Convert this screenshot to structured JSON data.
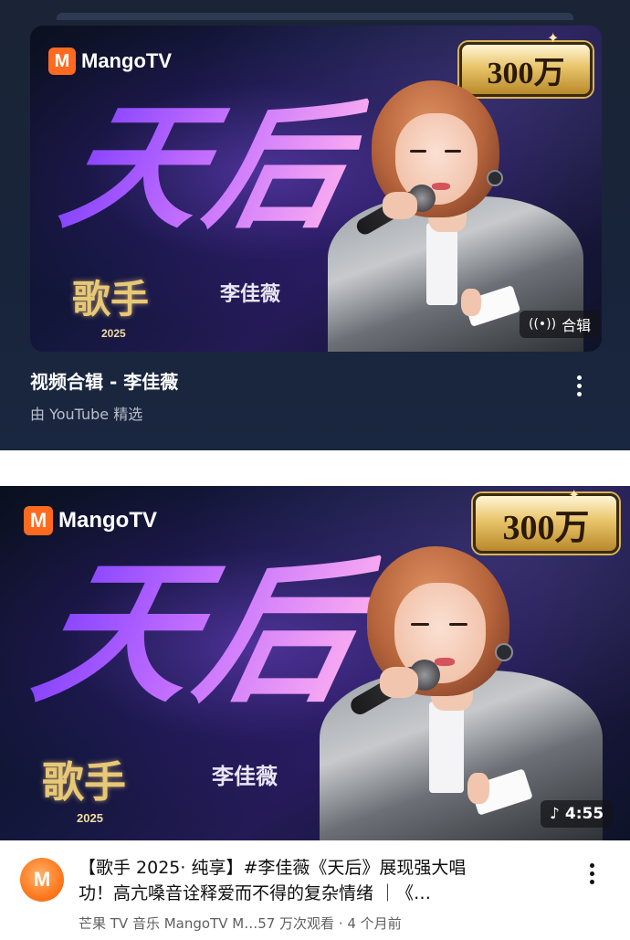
{
  "top_card": {
    "thumbnail": {
      "brand": "MangoTV",
      "brand_mark": "M",
      "badge": "300万",
      "headline": "天后",
      "artist": "李佳薇",
      "show_logo": "歌手",
      "show_year": "2025",
      "chip_icon": "broadcast-icon",
      "chip_label": "合辑"
    },
    "title": "视频合辑 - 李佳薇",
    "subtitle": "由 YouTube 精选"
  },
  "video": {
    "thumbnail": {
      "brand": "MangoTV",
      "brand_mark": "M",
      "badge": "300万",
      "headline": "天后",
      "artist": "李佳薇",
      "show_logo": "歌手",
      "show_year": "2025",
      "duration_icon": "music-note-icon",
      "duration": "4:55"
    },
    "channel_avatar": "M",
    "title_line1": "【歌手 2025· 纯享】#李佳薇《天后》展现强大唱",
    "title_line2": "功！高亢嗓音诠释爱而不得的复杂情绪 ｜《…",
    "meta": "芒果 TV 音乐 MangoTV M…57 万次观看 · 4 个月前"
  },
  "colors": {
    "card_background": "#1b2436",
    "accent_orange": "#ff6a1f",
    "headline_gradient": [
      "#7b3cff",
      "#ffb1f0"
    ],
    "badge_gold": "#e9c46a"
  }
}
